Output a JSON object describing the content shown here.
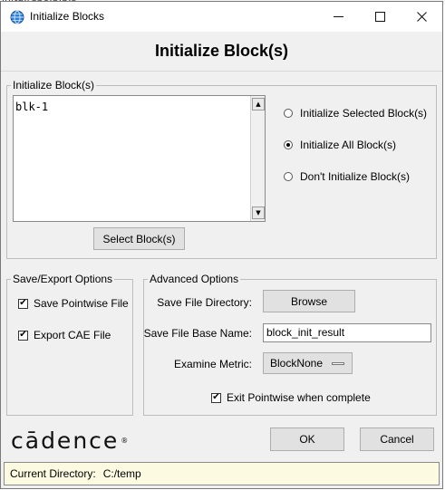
{
  "window": {
    "title": "Initialize Blocks",
    "minimize_glyph": "—",
    "maximize_glyph": "☐",
    "close_glyph": "✕"
  },
  "header": {
    "title": "Initialize Block(s)"
  },
  "init_group": {
    "legend": "Initialize Block(s)",
    "list_items": [
      "blk-1"
    ],
    "select_button": "Select Block(s)",
    "radios": [
      {
        "label": "Initialize Selected Block(s)",
        "selected": false
      },
      {
        "label": "Initialize All Block(s)",
        "selected": true
      },
      {
        "label": "Don't Initialize Block(s)",
        "selected": false
      }
    ]
  },
  "save_group": {
    "legend": "Save/Export Options",
    "options": [
      {
        "label": "Save Pointwise File",
        "checked": true
      },
      {
        "label": "Export CAE File",
        "checked": true
      }
    ]
  },
  "advanced_group": {
    "legend": "Advanced Options",
    "dir_label": "Save File Directory:",
    "browse_button": "Browse",
    "base_name_label": "Save File Base Name:",
    "base_name_value": "block_init_result",
    "metric_label": "Examine Metric:",
    "metric_value": "BlockNone",
    "exit_label": "Exit Pointwise when complete",
    "exit_checked": true
  },
  "footer": {
    "logo_text": "cādence",
    "logo_mark": "®",
    "ok_button": "OK",
    "cancel_button": "Cancel"
  },
  "status": {
    "label": "Current Directory:",
    "value": "C:/temp"
  },
  "icons": {
    "app": "globe-icon",
    "check": "✔",
    "scroll_up": "▲",
    "scroll_down": "▼"
  },
  "colors": {
    "dialog_bg": "#f0f0f0",
    "status_bg": "#fcfbe2"
  }
}
